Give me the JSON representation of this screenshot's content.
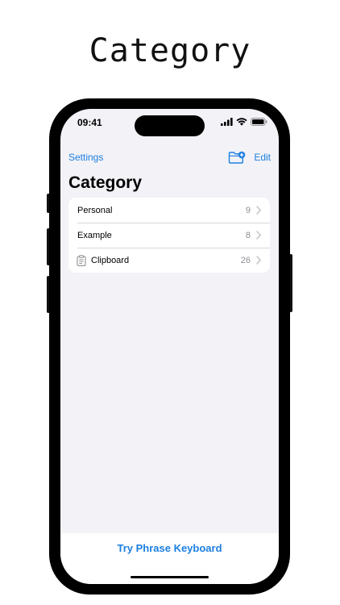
{
  "headline": "Category",
  "status_bar": {
    "time": "09:41",
    "icons": [
      "cellular-signal-icon",
      "wifi-icon",
      "battery-icon"
    ]
  },
  "nav": {
    "settings_label": "Settings",
    "new_folder_icon": "folder-plus-icon",
    "edit_label": "Edit"
  },
  "title": "Category",
  "categories": [
    {
      "label": "Personal",
      "count": "9"
    },
    {
      "label": "Example",
      "count": "8"
    },
    {
      "label": "Clipboard",
      "count": "26",
      "icon": "clipboard-icon"
    }
  ],
  "bottom": {
    "try_label": "Try Phrase Keyboard"
  },
  "colors": {
    "accent": "#1d7fe0",
    "background": "#f2f2f7",
    "secondary_text": "#8e8e93"
  }
}
